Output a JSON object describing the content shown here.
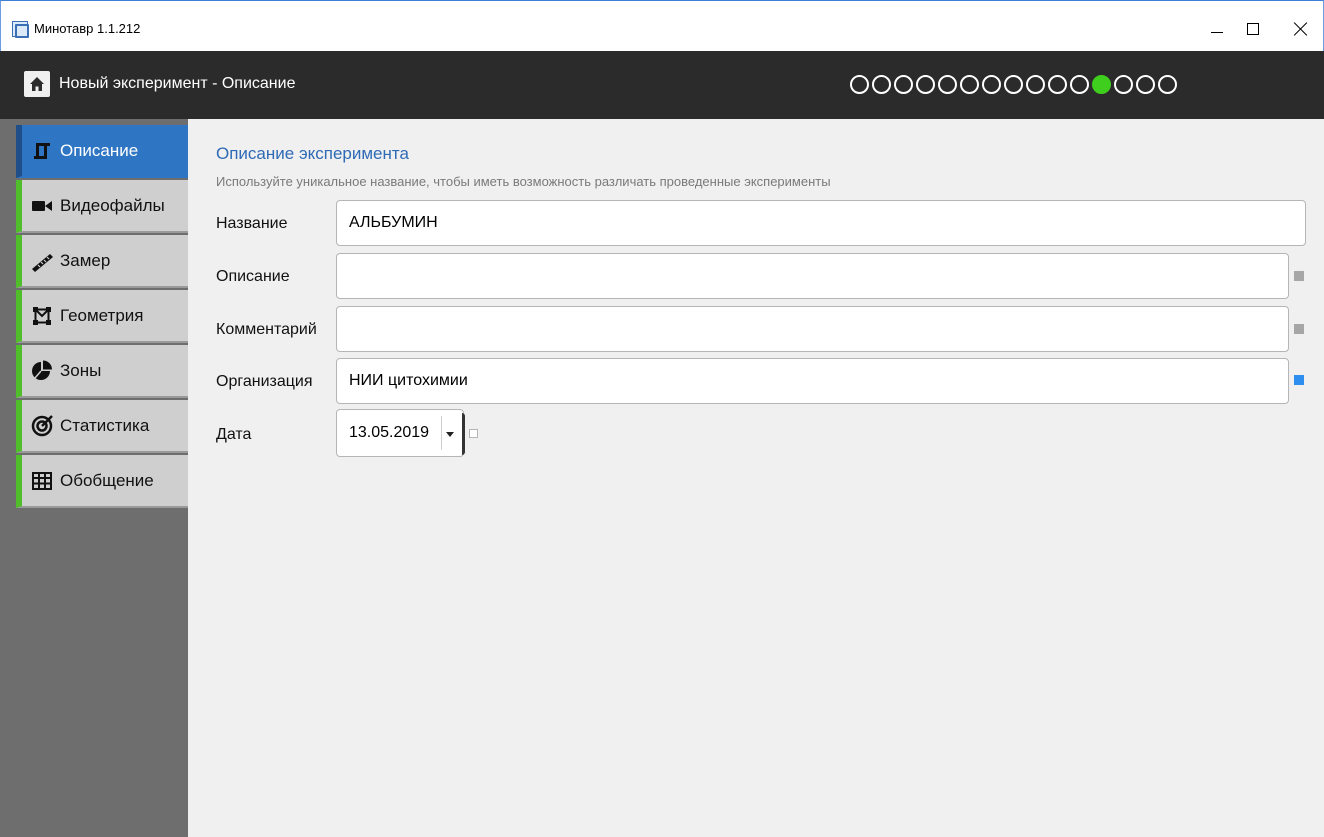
{
  "window": {
    "title": "Минотавр 1.1.212"
  },
  "header": {
    "title": "Новый эксперимент - Описание",
    "steps_total": 15,
    "active_step_index": 11,
    "active_color": "#3fce1e"
  },
  "sidebar": {
    "items": [
      {
        "label": "Описание",
        "icon": "description-icon",
        "active": true
      },
      {
        "label": "Видеофайлы",
        "icon": "video-camera-icon",
        "active": false
      },
      {
        "label": "Замер",
        "icon": "ruler-icon",
        "active": false
      },
      {
        "label": "Геометрия",
        "icon": "geometry-icon",
        "active": false
      },
      {
        "label": "Зоны",
        "icon": "pie-chart-icon",
        "active": false
      },
      {
        "label": "Статистика",
        "icon": "target-icon",
        "active": false
      },
      {
        "label": "Обобщение",
        "icon": "table-icon",
        "active": false
      }
    ],
    "accent_color": "#4fbe2a",
    "active_color": "#2e75c4"
  },
  "main": {
    "title": "Описание эксперимента",
    "hint": "Используйте уникальное название, чтобы иметь возможность различать проведенные эксперименты",
    "fields": {
      "name": {
        "label": "Название",
        "value": "АЛЬБУМИН"
      },
      "description": {
        "label": "Описание",
        "value": ""
      },
      "comment": {
        "label": "Комментарий",
        "value": ""
      },
      "organization": {
        "label": "Организация",
        "value": "НИИ цитохимии"
      },
      "date": {
        "label": "Дата",
        "value": "13.05.2019"
      }
    }
  }
}
